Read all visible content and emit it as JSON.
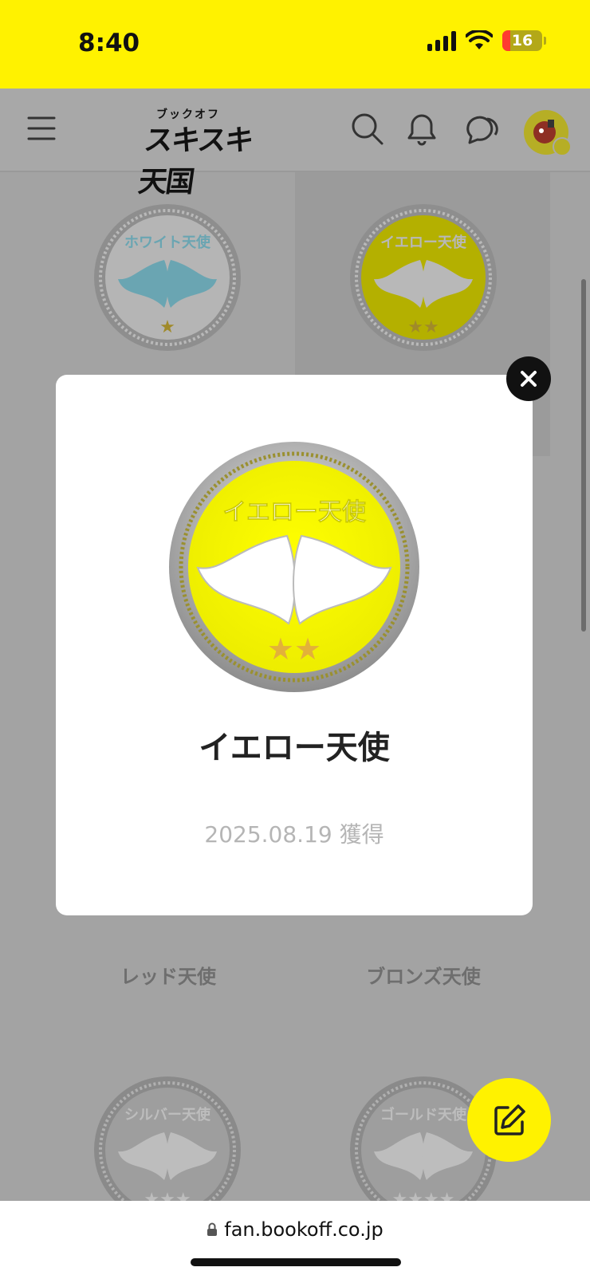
{
  "status_bar": {
    "time": "8:40",
    "battery": "16"
  },
  "header": {
    "logo_small": "ブックオフ",
    "logo_big": "スキスキ天国"
  },
  "grid": {
    "row1": [
      {
        "name": "ホワイト天使",
        "stars": 1
      },
      {
        "name": "イエロー天使",
        "stars": 2
      }
    ],
    "row2": [
      {
        "label": "レッド天使"
      },
      {
        "label": "ブロンズ天使"
      }
    ],
    "row3": [
      {
        "name": "シルバー天使",
        "stars": 3
      },
      {
        "name": "ゴールド天使",
        "stars": 4
      }
    ]
  },
  "modal": {
    "medal_text": "イエロー天使",
    "title": "イエロー天使",
    "date": "2025.08.19 獲得",
    "stars": 2
  },
  "colors": {
    "brand_yellow": "#fff200",
    "medal_yellow": "#ffff00",
    "wing_blue": "#7fc6d6"
  },
  "browser": {
    "url": "fan.bookoff.co.jp"
  }
}
